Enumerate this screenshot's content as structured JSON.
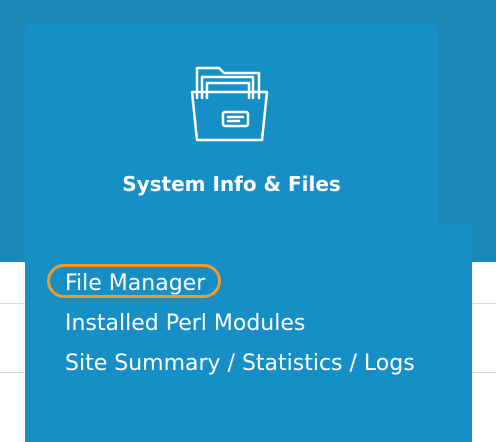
{
  "tile": {
    "title": "System Info & Files",
    "icon": "folder-icon"
  },
  "menu": {
    "items": [
      {
        "label": "File Manager",
        "highlighted": true
      },
      {
        "label": "Installed Perl Modules"
      },
      {
        "label": "Site Summary / Statistics / Logs"
      }
    ]
  },
  "colors": {
    "header_background": "#1a88b8",
    "tile_background": "#168fc6",
    "highlight_ring": "#f29a2e",
    "text": "#ffffff"
  }
}
